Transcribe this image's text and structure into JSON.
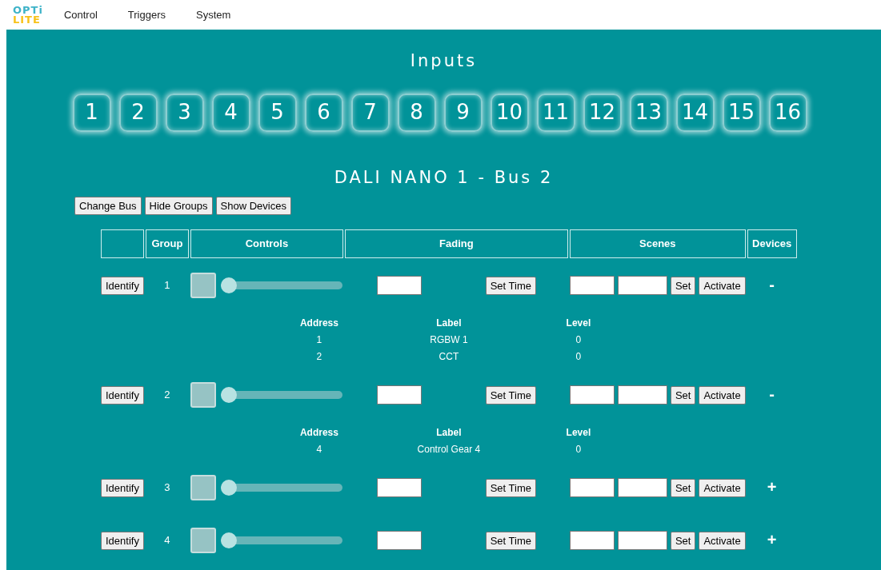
{
  "logo": {
    "top": "OPTi",
    "bottom": "LITE"
  },
  "nav": [
    "Control",
    "Triggers",
    "System"
  ],
  "inputs": {
    "title": "Inputs",
    "buttons": [
      "1",
      "2",
      "3",
      "4",
      "5",
      "6",
      "7",
      "8",
      "9",
      "10",
      "11",
      "12",
      "13",
      "14",
      "15",
      "16"
    ]
  },
  "bus": {
    "title": "DALI NANO 1 - Bus 2"
  },
  "toolbar": [
    "Change Bus",
    "Hide Groups",
    "Show Devices"
  ],
  "table": {
    "columns": [
      "",
      "Group",
      "Controls",
      "Fading",
      "Scenes",
      "Devices"
    ],
    "rows": [
      {
        "identify": "Identify",
        "group": "1",
        "level": 0,
        "set_time": "Set Time",
        "set": "Set",
        "activate": "Activate",
        "toggle": "-",
        "devices": {
          "columns": [
            "Address",
            "Label",
            "Level"
          ],
          "rows": [
            {
              "address": "1",
              "label": "RGBW 1",
              "level": "0"
            },
            {
              "address": "2",
              "label": "CCT",
              "level": "0"
            }
          ]
        }
      },
      {
        "identify": "Identify",
        "group": "2",
        "level": 0,
        "set_time": "Set Time",
        "set": "Set",
        "activate": "Activate",
        "toggle": "-",
        "devices": {
          "columns": [
            "Address",
            "Label",
            "Level"
          ],
          "rows": [
            {
              "address": "4",
              "label": "Control Gear 4",
              "level": "0"
            }
          ]
        }
      },
      {
        "identify": "Identify",
        "group": "3",
        "level": 0,
        "set_time": "Set Time",
        "set": "Set",
        "activate": "Activate",
        "toggle": "+"
      },
      {
        "identify": "Identify",
        "group": "4",
        "level": 0,
        "set_time": "Set Time",
        "set": "Set",
        "activate": "Activate",
        "toggle": "+"
      }
    ]
  }
}
